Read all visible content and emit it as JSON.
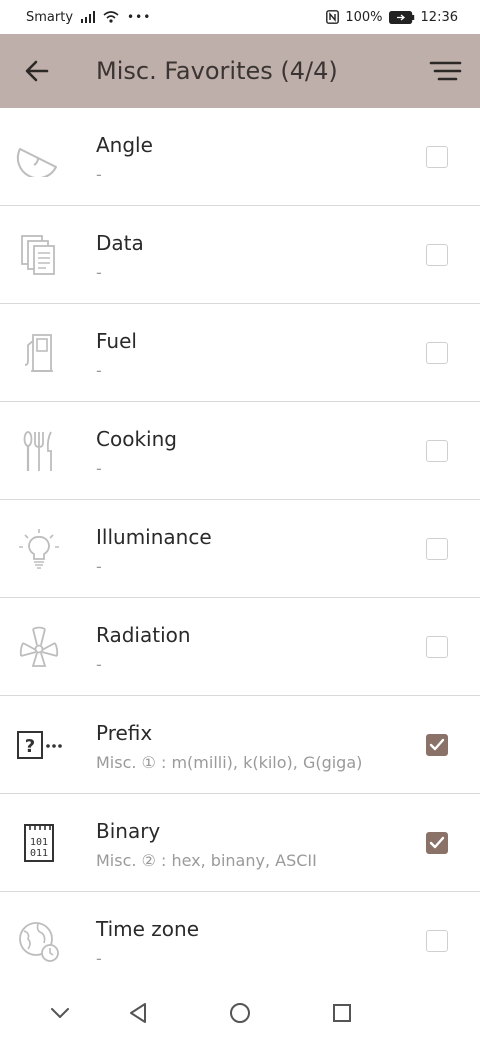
{
  "status_bar": {
    "carrier": "Smarty",
    "battery": "100%",
    "time": "12:36"
  },
  "app_bar": {
    "title": "Misc. Favorites (4/4)",
    "back_icon": "arrow-left-icon",
    "menu_icon": "sort-menu-icon"
  },
  "items": [
    {
      "name": "Angle",
      "desc": "-",
      "icon": "angle-icon",
      "checked": false
    },
    {
      "name": "Data",
      "desc": "-",
      "icon": "data-files-icon",
      "checked": false
    },
    {
      "name": "Fuel",
      "desc": "-",
      "icon": "fuel-pump-icon",
      "checked": false
    },
    {
      "name": "Cooking",
      "desc": "-",
      "icon": "cutlery-icon",
      "checked": false
    },
    {
      "name": "Illuminance",
      "desc": "-",
      "icon": "light-bulb-icon",
      "checked": false
    },
    {
      "name": "Radiation",
      "desc": "-",
      "icon": "radiation-icon",
      "checked": false
    },
    {
      "name": "Prefix",
      "desc": "Misc. ① : m(milli), k(kilo), G(giga)",
      "icon": "question-prefix-icon",
      "checked": true
    },
    {
      "name": "Binary",
      "desc": "Misc. ② : hex, binany, ASCII",
      "icon": "binary-chip-icon",
      "checked": true
    },
    {
      "name": "Time zone",
      "desc": "-",
      "icon": "globe-clock-icon",
      "checked": false
    }
  ],
  "colors": {
    "app_bar": "#bfafaa",
    "checked": "#8b7268",
    "divider": "#d9d9d9"
  }
}
